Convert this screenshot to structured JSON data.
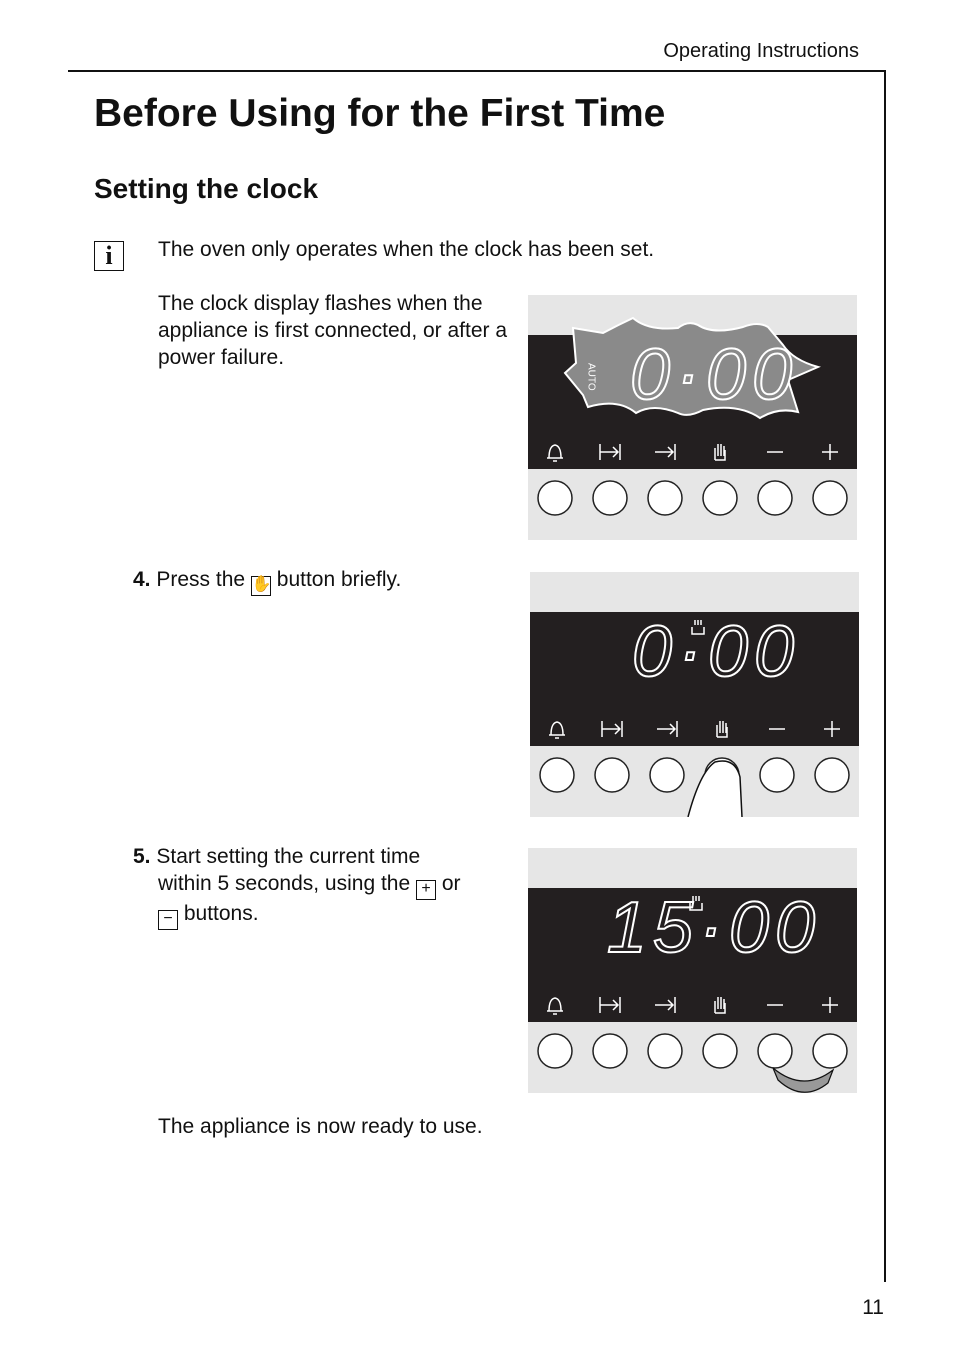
{
  "header": {
    "section": "Operating Instructions",
    "page_number": "11"
  },
  "title": "Before Using for the First Time",
  "subtitle": "Setting the clock",
  "info_icon": "info-icon",
  "note": "The oven only operates when the clock has been set.",
  "para1": "The clock display flashes when the appliance is first connected, or after a power failure.",
  "step4": {
    "num": "4.",
    "before": "Press the",
    "after": "button briefly.",
    "icon": "hand-icon"
  },
  "step5": {
    "num": "5.",
    "line1": "Start setting the current time",
    "line2a": "within 5 seconds, using the",
    "plus": "+",
    "or": "or",
    "minus": "−",
    "line3": "buttons."
  },
  "ready": "The appliance is now ready to use.",
  "button_symbols": [
    "bell-icon",
    "duration-icon",
    "end-time-icon",
    "hand-icon",
    "minus-icon",
    "plus-icon"
  ],
  "displays": [
    {
      "time": "0·00",
      "auto": "AUTO",
      "flashing": true
    },
    {
      "time": "0·00",
      "cook_indicator": true,
      "pressed_button": "hand"
    },
    {
      "time": "15·00",
      "cook_indicator": true,
      "pressed_buttons": [
        "minus",
        "plus"
      ]
    }
  ]
}
